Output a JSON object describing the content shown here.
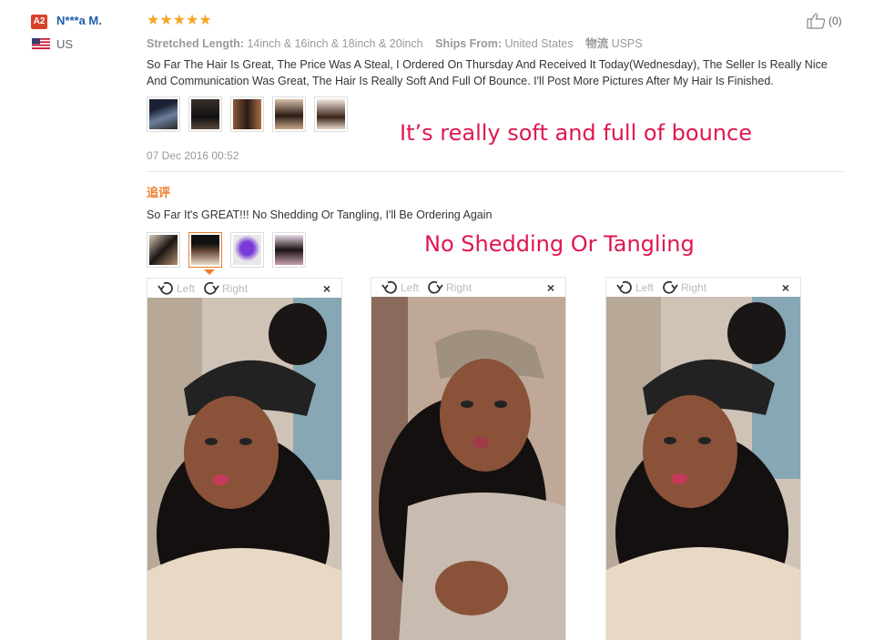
{
  "user": {
    "badge": "A2",
    "name": "N***a M.",
    "country": "US"
  },
  "rating": {
    "stars": "★★★★★"
  },
  "like": {
    "count": "(0)"
  },
  "meta": {
    "length_label": "Stretched Length:",
    "length_value": "14inch & 16inch & 18inch & 20inch",
    "ships_label": "Ships From:",
    "ships_value": "United States",
    "logistics_label": "物流",
    "logistics_value": "USPS"
  },
  "review1": {
    "text": "So Far The Hair Is Great, The Price Was A Steal, I Ordered On Thursday And Received It Today(Wednesday), The Seller Is Really Nice And Communication Was Great, The Hair Is Really Soft And Full Of Bounce. I'll Post More Pictures After My Hair Is Finished.",
    "date": "07 Dec 2016 00:52",
    "caption": "It’s really soft and full of bounce"
  },
  "followup": {
    "label": "追评",
    "text": "So Far It's GREAT!!! No Shedding Or Tangling, I'll Be Ordering Again",
    "caption": "No Shedding Or Tangling"
  },
  "viewer": {
    "left_label": "Left",
    "right_label": "Right",
    "close": "×"
  },
  "colors": {
    "accent": "#f07c2b",
    "caption": "#e0174f",
    "link": "#1f5fa8",
    "star": "#f5a623"
  }
}
